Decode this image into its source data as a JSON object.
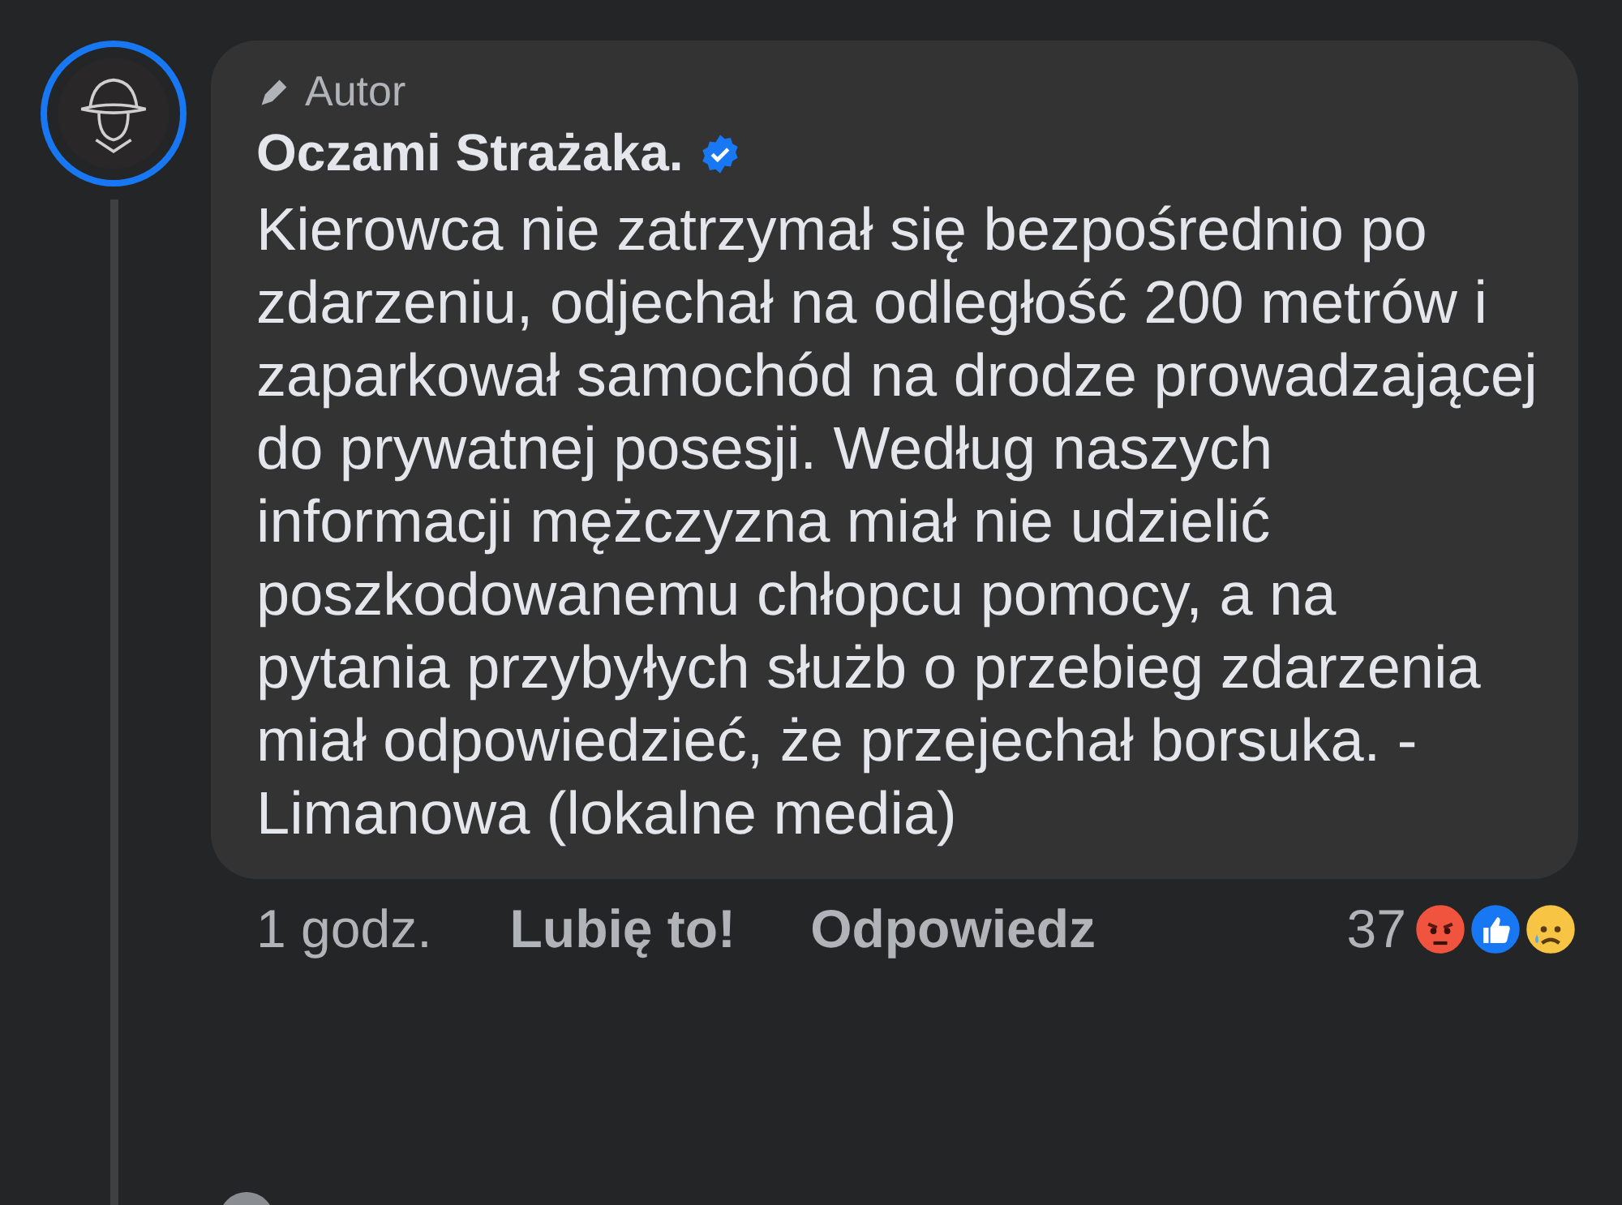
{
  "comment": {
    "author_badge": "Autor",
    "author": "Oczami Strażaka.",
    "verified": true,
    "text": "Kierowca nie zatrzymał się bezpośrednio po zdarzeniu, odjechał na odległość 200 metrów i zaparkował samochód na drodze prowadzającej do prywatnej posesji. Według naszych informacji mężczyzna miał nie udzielić poszkodowanemu chłopcu pomocy, a na pytania przybyłych służb o przebieg zdarzenia miał odpowiedzieć, że przejechał borsuka.   - Limanowa (lokalne media)",
    "time": "1 godz.",
    "like_label": "Lubię to!",
    "reply_label": "Odpowiedz",
    "reaction_count": "37",
    "reactions": [
      {
        "kind": "angry"
      },
      {
        "kind": "like"
      },
      {
        "kind": "sad"
      }
    ]
  }
}
